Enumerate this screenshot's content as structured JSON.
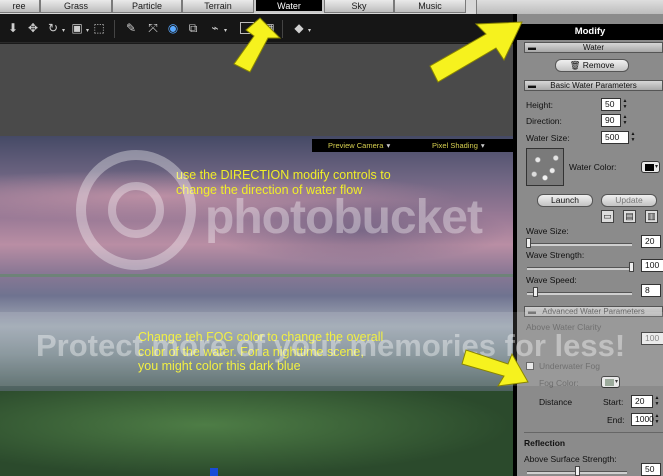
{
  "tabs": [
    {
      "label": "ree",
      "active": false
    },
    {
      "label": "Grass",
      "active": false
    },
    {
      "label": "Particle",
      "active": false
    },
    {
      "label": "Terrain",
      "active": false
    },
    {
      "label": "Water",
      "active": true
    },
    {
      "label": "Sky",
      "active": false
    },
    {
      "label": "Music",
      "active": false
    }
  ],
  "toolbar": {
    "icons": [
      "arrow-down-icon",
      "move-icon",
      "rotate-icon",
      "scale-icon",
      "select-region-icon",
      "paint-icon",
      "transform-icon",
      "globe-icon",
      "clone-icon",
      "graph-icon",
      "window-icon",
      "grid-icon",
      "brush-icon"
    ]
  },
  "viewport": {
    "camera_label": "Preview Camera",
    "shading_label": "Pixel Shading",
    "note_direction": [
      "use the DIRECTION modify controls to",
      "change the direction of water flow"
    ],
    "note_fog": [
      "Change teh FOG color to change the overall",
      "color of the water. For a nighttime scene,",
      "you might color this dark blue"
    ]
  },
  "panel": {
    "title": "Modify",
    "object_header": "Water",
    "remove_label": "Remove",
    "basic_header": "Basic Water Parameters",
    "height_label": "Height:",
    "height_value": "50",
    "direction_label": "Direction:",
    "direction_value": "90",
    "water_size_label": "Water Size:",
    "water_size_value": "500",
    "water_color_label": "Water Color:",
    "water_color": "#000000",
    "launch_label": "Launch",
    "update_label": "Update",
    "wave_size_label": "Wave Size:",
    "wave_size_value": "20",
    "wave_strength_label": "Wave Strength:",
    "wave_strength_value": "100",
    "wave_speed_label": "Wave Speed:",
    "wave_speed_value": "8",
    "advanced_header": "Advanced Water Parameters",
    "above_clarity_label": "Above Water Clarity",
    "above_clarity_value": "100",
    "underwater_fog_label": "Underwater Fog",
    "fog_color_label": "Fog Color:",
    "fog_color": "#8fa08f",
    "distance_label": "Distance",
    "start_label": "Start:",
    "start_value": "20",
    "end_label": "End:",
    "end_value": "1000",
    "reflection_label": "Reflection",
    "surface_strength_label": "Above Surface Strength:",
    "surface_strength_value": "50"
  },
  "watermark": {
    "brand": "photobucket",
    "protect": "Protect more of your memories for less!"
  },
  "colors": {
    "annotation": "#f1ee28",
    "arrow": "#f6f21e"
  }
}
